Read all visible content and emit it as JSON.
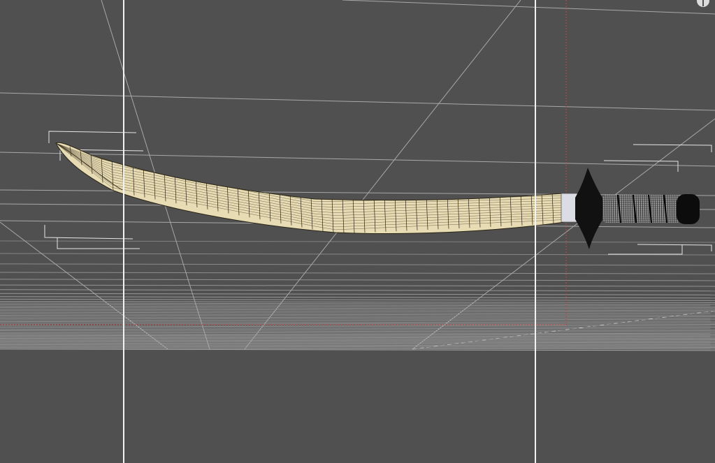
{
  "viewport": {
    "background": "#505050",
    "grid_color": "#a8a8a8",
    "guide_color": "#f2f2f2",
    "axis_color": "#c04848"
  },
  "model": {
    "blade_color": "#e8dcb4",
    "guard_color": "#111111",
    "collar_color": "#dcdce4",
    "grip_color": "#9a9a9a",
    "pommel_color": "#0c0c0c"
  },
  "icons": {
    "corner": "viewport-options-icon"
  }
}
